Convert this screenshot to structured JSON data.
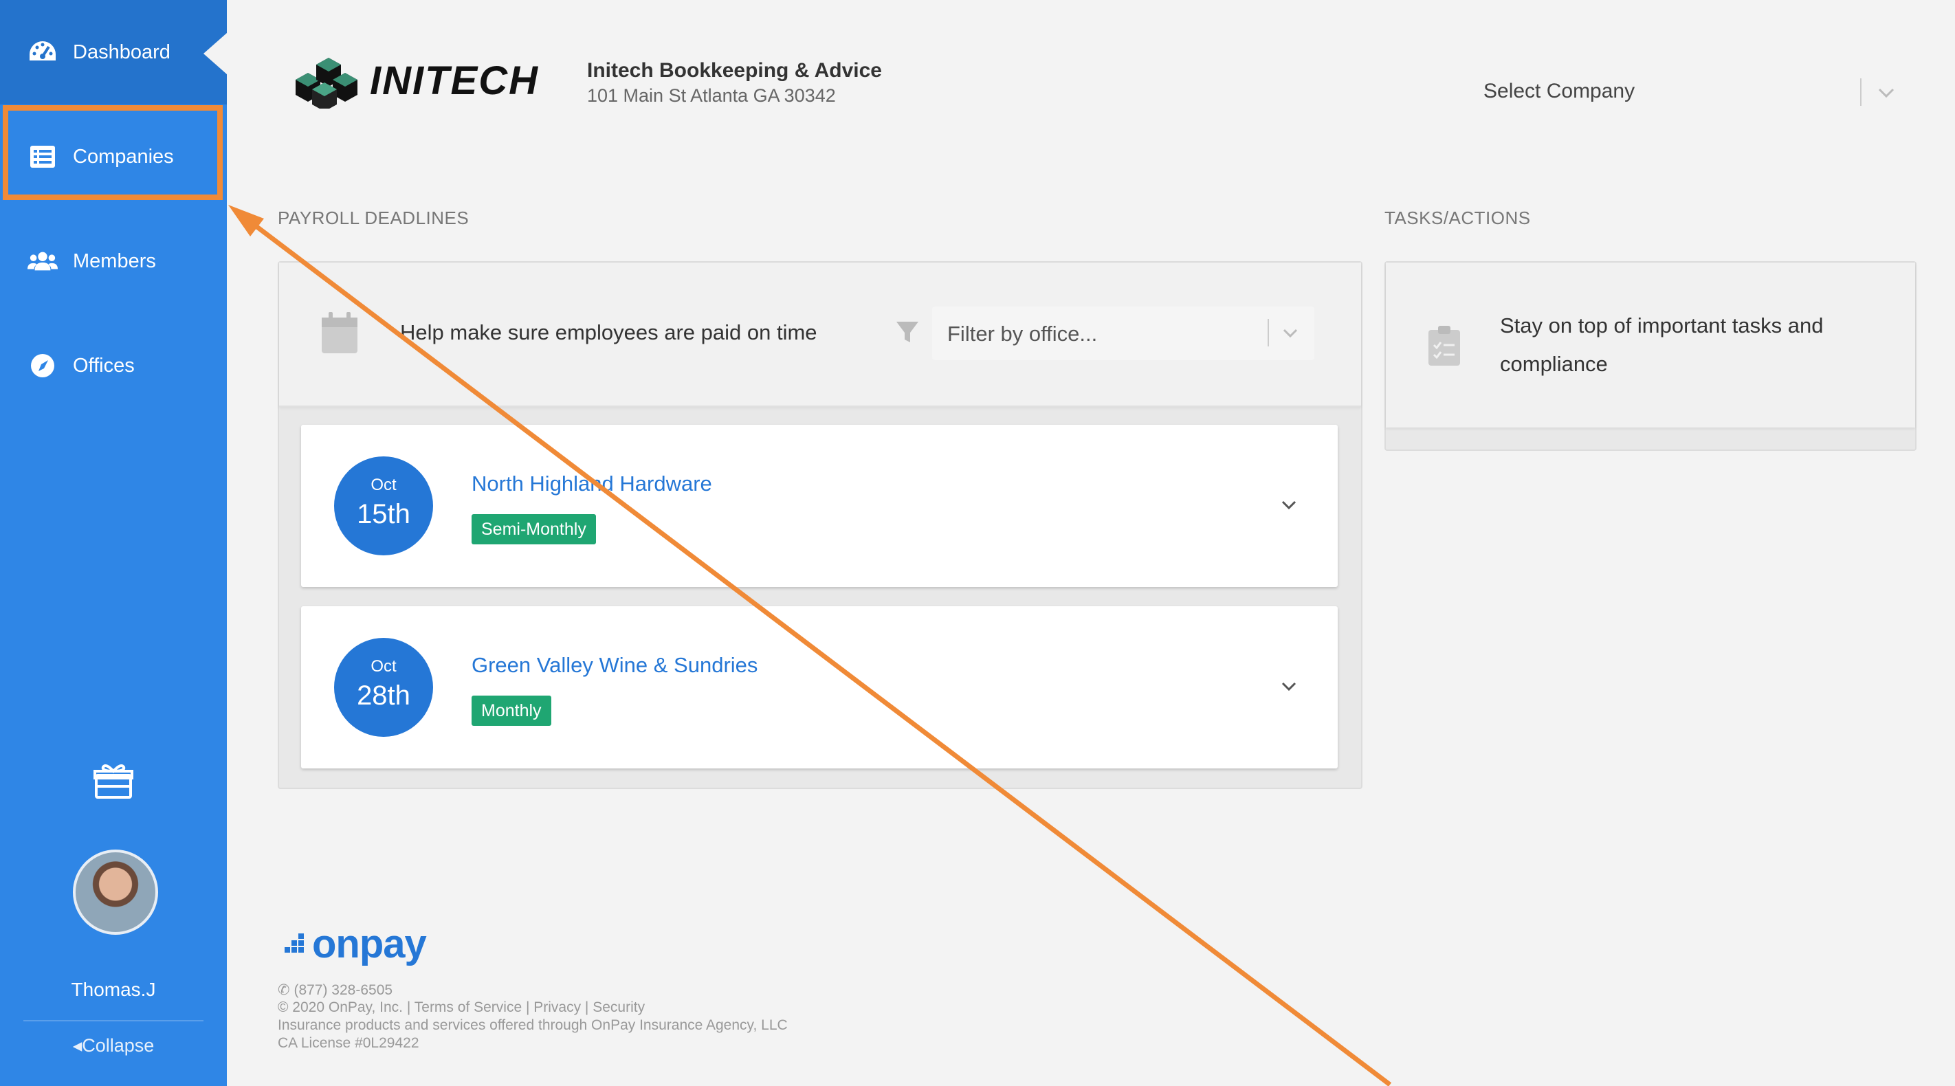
{
  "sidebar": {
    "items": [
      {
        "label": "Dashboard",
        "icon": "dashboard-icon"
      },
      {
        "label": "Companies",
        "icon": "list-icon"
      },
      {
        "label": "Members",
        "icon": "users-icon"
      },
      {
        "label": "Offices",
        "icon": "compass-icon"
      }
    ],
    "username": "Thomas.J",
    "collapse_label": "Collapse",
    "collapse_icon": "caret-left-icon"
  },
  "header": {
    "logo_text": "INITECH",
    "company_name": "Initech Bookkeeping & Advice",
    "company_address": "101 Main St Atlanta GA 30342",
    "select_company_placeholder": "Select Company"
  },
  "payroll": {
    "section_label": "PAYROLL DEADLINES",
    "help_text": "Help make sure employees are paid on time",
    "filter_placeholder": "Filter by office...",
    "deadlines": [
      {
        "month": "Oct",
        "day": "15th",
        "company": "North Highland Hardware",
        "frequency": "Semi-Monthly"
      },
      {
        "month": "Oct",
        "day": "28th",
        "company": "Green Valley Wine & Sundries",
        "frequency": "Monthly"
      }
    ]
  },
  "tasks": {
    "section_label": "TASKS/ACTIONS",
    "message": "Stay on top of important tasks and compliance"
  },
  "footer": {
    "brand": "onpay",
    "phone": "(877) 328-6505",
    "copyright": "© 2020 OnPay, Inc. | Terms of Service | Privacy | Security",
    "insurance": "Insurance products and services offered through OnPay Insurance Agency, LLC",
    "license": "CA License #0L29422"
  },
  "colors": {
    "sidebar": "#2f86e6",
    "sidebar_active": "#2473cc",
    "accent": "#2577d6",
    "badge": "#1fa672",
    "annotation": "#f08a37",
    "background": "#f3f3f3"
  }
}
